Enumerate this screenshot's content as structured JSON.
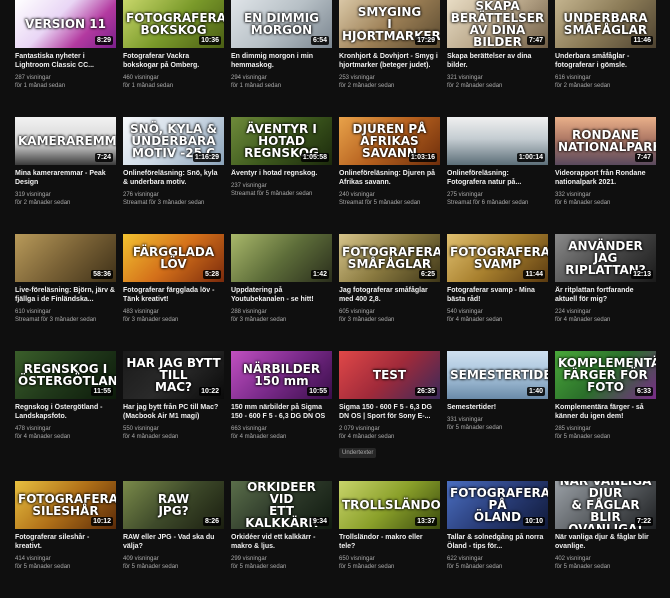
{
  "videos": [
    {
      "thumb_text": "VERSION 11",
      "duration": "8:29",
      "title": "Fantastiska nyheter i Lightroom Classic CC...",
      "views": "287 visningar",
      "age": "för 1 månad sedan",
      "bg": "linear-gradient(135deg,#ffffff 0%,#e9d6f5 40%,#b33aa0 70%,#7a1e8a 100%)"
    },
    {
      "thumb_text": "FOTOGRAFERAR\nBOKSKOG",
      "duration": "10:36",
      "title": "Fotograferar Vackra bokskogar på Omberg.",
      "views": "460 visningar",
      "age": "för 1 månad sedan",
      "bg": "linear-gradient(135deg,#c7d66a 0%,#7a9a2a 50%,#4a5e14 100%)"
    },
    {
      "thumb_text": "EN DIMMIG MORGON",
      "duration": "6:54",
      "title": "En dimmig morgon i min hemmaskog.",
      "views": "294 visningar",
      "age": "för 1 månad sedan",
      "bg": "linear-gradient(135deg,#dfe4e8 0%,#b7c0c6 50%,#7b8690 100%)"
    },
    {
      "thumb_text": "SMYGING\nI HJORTMARKER",
      "duration": "17:29",
      "title": "Kronhjort & Dovhjort - Smyg i hjortmarker (beteger judet).",
      "views": "253 visningar",
      "age": "för 2 månader sedan",
      "bg": "linear-gradient(135deg,#d9c7a6 0%,#9c7f55 50%,#5a4a30 100%)"
    },
    {
      "thumb_text": "SKAPA BERÄTTELSER\nAV DINA BILDER",
      "duration": "7:47",
      "title": "Skapa berättelser av dina bilder.",
      "views": "321 visningar",
      "age": "för 2 månader sedan",
      "bg": "linear-gradient(135deg,#e8dcc4 0%,#b9a78a 50%,#6e5c44 100%)"
    },
    {
      "thumb_text": "UNDERBARA\nSMÅFÅGLAR",
      "duration": "11:46",
      "title": "Underbara småfåglar - fotograferar i gömsle.",
      "views": "616 visningar",
      "age": "för 2 månader sedan",
      "bg": "linear-gradient(135deg,#c3b38e 0%,#8a7a56 50%,#4d4230 100%)"
    },
    {
      "thumb_text": "KAMERAREMMAR",
      "duration": "7:24",
      "title": "Mina kameraremmar - Peak Design",
      "views": "319 visningar",
      "age": "för 2 månader sedan",
      "bg": "linear-gradient(180deg,#f2f2f2 0%,#d5d5d5 55%,#3a3a3a 100%)"
    },
    {
      "thumb_text": "SNÖ, KYLA &\nUNDERBARA\nMOTIV  -25 C",
      "duration": "1:16:29",
      "title": "Onlineföreläsning: Snö, kyla & underbara motiv.",
      "views": "276 visningar",
      "age": "Streamat för 3 månader sedan",
      "bg": "linear-gradient(135deg,#f5f7fa 0%,#cdd9e5 50%,#8aa2b8 100%)"
    },
    {
      "thumb_text": "ÄVENTYR I\nHOTAD\nREGNSKOG",
      "duration": "1:05:58",
      "title": "Äventyr i hotad regnskog.",
      "views": "237 visningar",
      "age": "Streamat för 5 månader sedan",
      "bg": "linear-gradient(135deg,#6e8a3a 0%,#3e5a1e 50%,#1c2a0c 100%)"
    },
    {
      "thumb_text": "DJUREN PÅ\nAFRIKAS\nSAVANN",
      "duration": "1:03:16",
      "title": "Onlineföreläsning: Djuren på Afrikas savann.",
      "views": "240 visningar",
      "age": "Streamat för 5 månader sedan",
      "bg": "linear-gradient(135deg,#e8a24a 0%,#b5601e 50%,#6e2e0c 100%)"
    },
    {
      "thumb_text": "",
      "duration": "1:00:14",
      "title": "Onlineföreläsning: Fotografera natur på...",
      "views": "275 visningar",
      "age": "Streamat för 6 månader sedan",
      "bg": "linear-gradient(180deg,#f0f0f0 0%,#c5cdd2 45%,#5c6e78 100%)"
    },
    {
      "thumb_text": "RONDANE\nNATIONALPARK",
      "duration": "7:47",
      "title": "Videorapport från Rondane nationalpark 2021.",
      "views": "332 visningar",
      "age": "för 6 månader sedan",
      "bg": "linear-gradient(180deg,#e9b08a 0%,#b07a66 45%,#5a4a5e 100%)"
    },
    {
      "thumb_text": "",
      "duration": "58:36",
      "title": "Live-föreläsning: Björn, järv & fjällga i de Finländska...",
      "views": "610 visningar",
      "age": "Streamat för 3 månader sedan",
      "bg": "linear-gradient(135deg,#b89a5a 0%,#7a6236 50%,#3e3018 100%)"
    },
    {
      "thumb_text": "FÄRGGLADA LÖV",
      "duration": "5:28",
      "title": "Fotograferar färgglada löv - Tänk kreativt!",
      "views": "483 visningar",
      "age": "för 3 månader sedan",
      "bg": "linear-gradient(135deg,#f2c230 0%,#d4701a 50%,#7a2a0c 100%)"
    },
    {
      "thumb_text": "",
      "duration": "1:42",
      "title": "Uppdatering på Youtubekanalen - se hitt!",
      "views": "288 visningar",
      "age": "för 3 månader sedan",
      "bg": "linear-gradient(135deg,#a9b86a 0%,#5e6e3a 50%,#2a2e1c 100%)"
    },
    {
      "thumb_text": "FOTOGRAFERAR\nSMÅFÅGLAR",
      "duration": "6:25",
      "title": "Jag fotograferar småfåglar med 400 2,8.",
      "views": "605 visningar",
      "age": "för 3 månader sedan",
      "bg": "linear-gradient(135deg,#d6c48a 0%,#8a7a40 50%,#3e3618 100%)"
    },
    {
      "thumb_text": "FOTOGRAFERAR\nSVAMP",
      "duration": "11:44",
      "title": "Fotograferar svamp - Mina bästa råd!",
      "views": "540 visningar",
      "age": "för 4 månader sedan",
      "bg": "linear-gradient(135deg,#e0c070 0%,#a8802e 50%,#5a3a10 100%)"
    },
    {
      "thumb_text": "ANVÄNDER JAG\nRIPLATTAN?",
      "duration": "12:13",
      "title": "Är ritplattan fortfarande aktuell för mig?",
      "views": "224 visningar",
      "age": "för 4 månader sedan",
      "bg": "linear-gradient(135deg,#8a8a8a 0%,#4a4a4a 50%,#1a1a1a 100%)"
    },
    {
      "thumb_text": "REGNSKOG I\nÖSTERGÖTLAND",
      "duration": "11:55",
      "title": "Regnskog i Östergötland - Landskapsfoto.",
      "views": "478 visningar",
      "age": "för 4 månader sedan",
      "bg": "linear-gradient(135deg,#3a5e2a 0%,#20381a 50%,#0c1a0a 100%)"
    },
    {
      "thumb_text": "HAR JAG BYTT TILL\nMAC?",
      "duration": "10:22",
      "title": "Har jag bytt från PC till Mac? (Macbook Air M1 magi)",
      "views": "550 visningar",
      "age": "för 4 månader sedan",
      "bg": "linear-gradient(135deg,#1a1a1a 0%,#2a2a2a 50%,#0a0a0a 100%)"
    },
    {
      "thumb_text": "NÄRBILDER\n150 mm",
      "duration": "10:55",
      "title": "150 mm närbilder på Sigma 150 - 600 F 5 - 6,3 DG DN OS",
      "views": "663 visningar",
      "age": "för 4 månader sedan",
      "bg": "linear-gradient(135deg,#c050c0 0%,#7a2a8a 50%,#3a0e4a 100%)"
    },
    {
      "thumb_text": "TEST",
      "duration": "26:35",
      "title": "Sigma 150 - 600 F 5 - 6,3 DG DN OS | Sport för Sony E-...",
      "views": "2 079 visningar",
      "age": "för 4 månader sedan",
      "bg": "linear-gradient(135deg,#e04848 0%,#a02a3a 50%,#3a2a5a 100%)"
    },
    {
      "thumb_text": "SEMESTERTIDER!",
      "duration": "1:40",
      "title": "Semestertider!",
      "views": "331 visningar",
      "age": "för 5 månader sedan",
      "bg": "linear-gradient(180deg,#cfe0f0 0%,#a8c4dc 50%,#6a8aa8 100%)"
    },
    {
      "thumb_text": "KOMPLEMENTÄRA\nFÄRGER FÖR FOTO",
      "duration": "6:33",
      "title": "Komplementära färger - så känner du igen dem!",
      "views": "285 visningar",
      "age": "för 5 månader sedan",
      "bg": "linear-gradient(135deg,#4aa83a 0%,#2a6e2a 50%,#7a2a8a 100%)"
    },
    {
      "thumb_text": "FOTOGRAFERAR\nSILESHÅR",
      "duration": "10:12",
      "title": "Fotograferar sileshår - kreativt.",
      "views": "414 visningar",
      "age": "för 5 månader sedan",
      "bg": "linear-gradient(135deg,#e8c040 0%,#b07018 50%,#5a2a08 100%)"
    },
    {
      "thumb_text": "RAW\nJPG?",
      "duration": "8:26",
      "title": "RAW eller JPG - Vad ska du välja?",
      "views": "409 visningar",
      "age": "för 5 månader sedan",
      "bg": "linear-gradient(135deg,#7a8a4a 0%,#3e4a2a 50%,#1a1e10 100%)"
    },
    {
      "thumb_text": "ORKIDÉER VID\nETT KALKKÄRR",
      "duration": "9:34",
      "title": "Orkidéer vid ett kalkkärr - makro & ljus.",
      "views": "299 visningar",
      "age": "för 5 månader sedan",
      "bg": "linear-gradient(135deg,#5a6e4a 0%,#2e3a2a 50%,#101a10 100%)"
    },
    {
      "thumb_text": "TROLLSLÄNDOR",
      "duration": "13:37",
      "title": "Trollsländor - makro eller tele?",
      "views": "650 visningar",
      "age": "för 5 månader sedan",
      "bg": "linear-gradient(135deg,#c8d46a 0%,#8aa02a 50%,#3a4a0e 100%)"
    },
    {
      "thumb_text": "FOTOGRAFERAR PÅ\nÖLAND",
      "duration": "10:10",
      "title": "Tallar & solnedgång på norra Öland - tips för...",
      "views": "622 visningar",
      "age": "för 5 månader sedan",
      "bg": "linear-gradient(135deg,#4a6ec0 0%,#2a3e7a 50%,#101a3a 100%)"
    },
    {
      "thumb_text": "NÄR VANLIGA DJUR\n& FÅGLAR BLIR\nOVANLIGA!",
      "duration": "7:22",
      "title": "När vanliga djur & fåglar blir ovanlige.",
      "views": "402 visningar",
      "age": "för 5 månader sedan",
      "bg": "linear-gradient(135deg,#9aa0a6 0%,#5a5e62 50%,#1e2022 100%)"
    }
  ],
  "badge_text": "Undertexter"
}
